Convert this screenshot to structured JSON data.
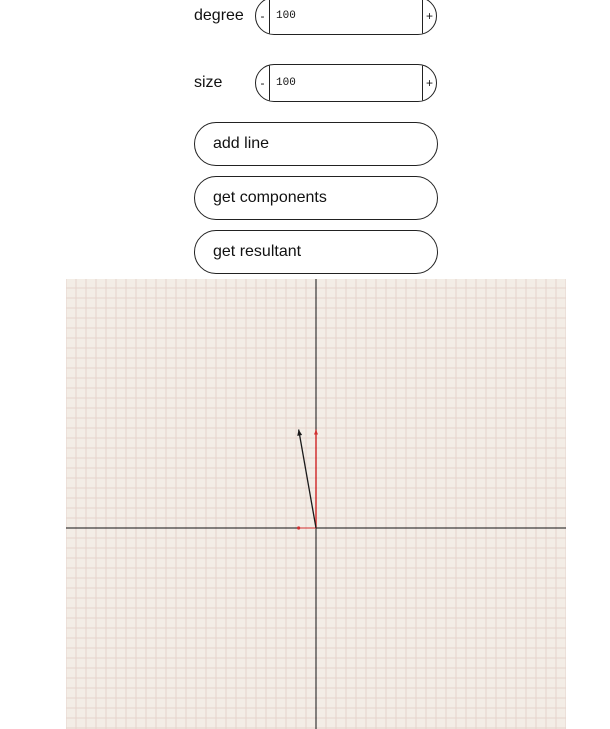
{
  "controls": {
    "degree": {
      "label": "degree",
      "minus": "-",
      "plus": "+",
      "value": "100"
    },
    "size": {
      "label": "size",
      "minus": "-",
      "plus": "+",
      "value": "100"
    },
    "buttons": {
      "add_line": "add line",
      "get_components": "get components",
      "get_resultant": "get resultant"
    }
  },
  "plot": {
    "grid": true,
    "vectors": [
      {
        "type": "line",
        "degree": 100,
        "size": 100,
        "color": "#1a1a1a"
      },
      {
        "type": "component-x",
        "color": "#d03030"
      },
      {
        "type": "component-y",
        "color": "#d03030"
      }
    ]
  }
}
